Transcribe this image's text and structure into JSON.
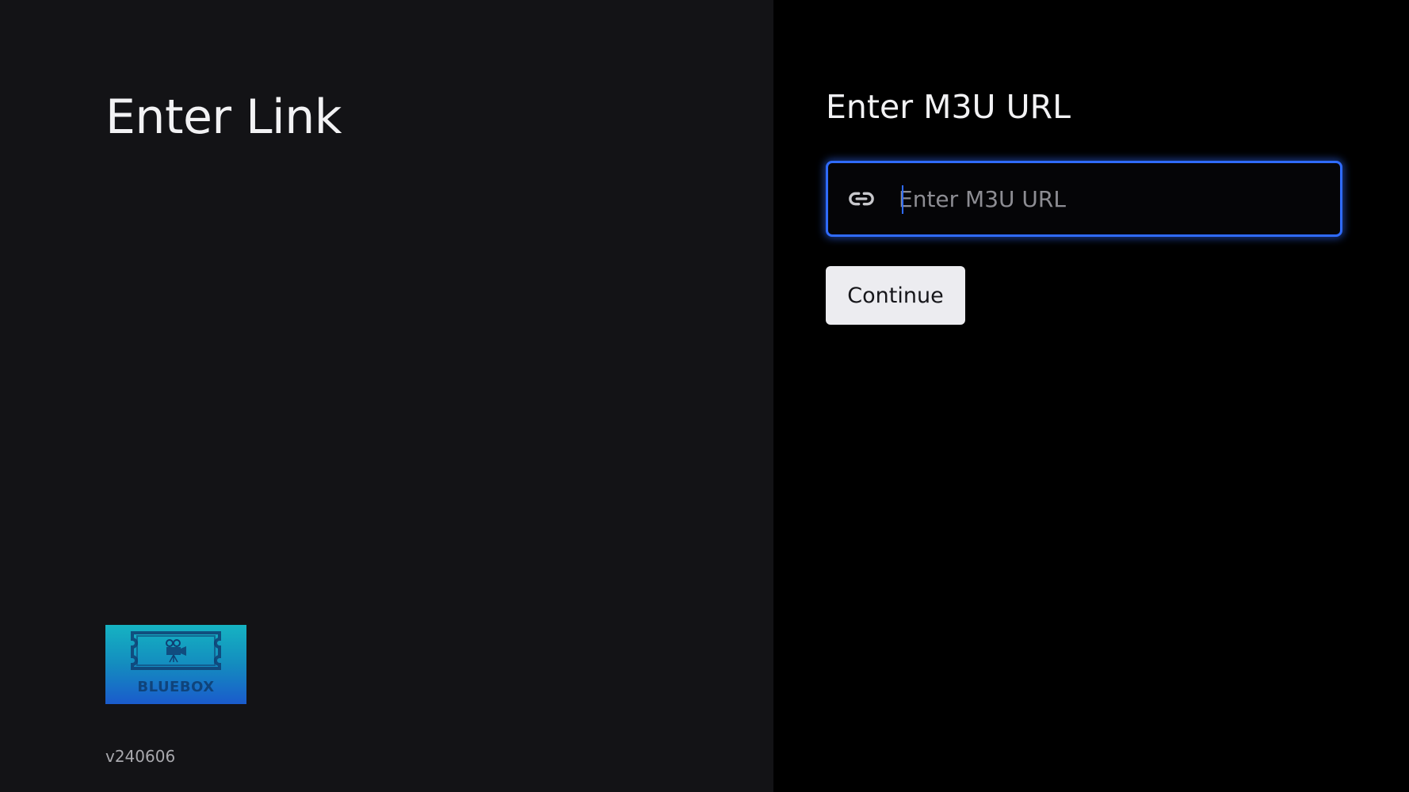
{
  "left_panel": {
    "title": "Enter Link",
    "logo": {
      "text": "BLUEBOX",
      "icon": "film-camera-icon"
    },
    "version": "v240606"
  },
  "right_panel": {
    "section_title": "Enter M3U URL",
    "url_field": {
      "icon": "link-icon",
      "placeholder": "Enter M3U URL",
      "value": ""
    },
    "continue_label": "Continue"
  },
  "colors": {
    "left_background": "#131316",
    "right_background": "#000000",
    "focus_accent": "#2f6bff",
    "button_background": "#ececf0",
    "button_text": "#16161a",
    "title_text": "#f2f2f4",
    "muted_text": "#a8a8ad"
  }
}
